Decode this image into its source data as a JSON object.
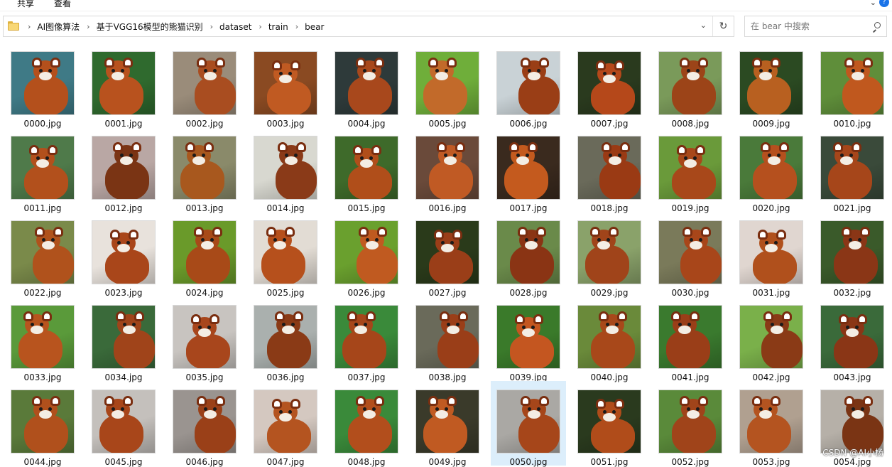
{
  "ribbon": {
    "share_label": "共享",
    "view_label": "查看"
  },
  "address": {
    "crumbs": [
      "AI图像算法",
      "基于VGG16模型的熊猫识别",
      "dataset",
      "train",
      "bear"
    ]
  },
  "search": {
    "placeholder": "在 bear 中搜索"
  },
  "files": [
    {
      "name": "0000.jpg",
      "bg": "#3f7a86",
      "fur": "#b4501c"
    },
    {
      "name": "0001.jpg",
      "bg": "#2f6a2e",
      "fur": "#b8521e"
    },
    {
      "name": "0002.jpg",
      "bg": "#9a8c7a",
      "fur": "#a94d20"
    },
    {
      "name": "0003.jpg",
      "bg": "#8a4a22",
      "fur": "#c05a22"
    },
    {
      "name": "0004.jpg",
      "bg": "#2e3a3a",
      "fur": "#a8481c"
    },
    {
      "name": "0005.jpg",
      "bg": "#6fae3a",
      "fur": "#c26a2a"
    },
    {
      "name": "0006.jpg",
      "bg": "#c9d2d6",
      "fur": "#9a3e16"
    },
    {
      "name": "0007.jpg",
      "bg": "#2a3a1e",
      "fur": "#b5481a"
    },
    {
      "name": "0008.jpg",
      "bg": "#7a9a5a",
      "fur": "#9c4418"
    },
    {
      "name": "0009.jpg",
      "bg": "#2b4a22",
      "fur": "#b86020"
    },
    {
      "name": "0010.jpg",
      "bg": "#5f8e3a",
      "fur": "#c0581e"
    },
    {
      "name": "0011.jpg",
      "bg": "#4f7a4a",
      "fur": "#b2501c"
    },
    {
      "name": "0012.jpg",
      "bg": "#b9a7a4",
      "fur": "#7a3414"
    },
    {
      "name": "0013.jpg",
      "bg": "#8a8a6a",
      "fur": "#a8581e"
    },
    {
      "name": "0014.jpg",
      "bg": "#d8d8d0",
      "fur": "#8a3a18"
    },
    {
      "name": "0015.jpg",
      "bg": "#3e6a2a",
      "fur": "#b04e1a"
    },
    {
      "name": "0016.jpg",
      "bg": "#6a4a3a",
      "fur": "#c05a24"
    },
    {
      "name": "0017.jpg",
      "bg": "#3a2a1e",
      "fur": "#c45a1e"
    },
    {
      "name": "0018.jpg",
      "bg": "#6a6a5a",
      "fur": "#9a3a14"
    },
    {
      "name": "0019.jpg",
      "bg": "#6a9a3a",
      "fur": "#a8481a"
    },
    {
      "name": "0020.jpg",
      "bg": "#4a7a3a",
      "fur": "#b5501e"
    },
    {
      "name": "0021.jpg",
      "bg": "#3a4a3a",
      "fur": "#a6461a"
    },
    {
      "name": "0022.jpg",
      "bg": "#7a8a4a",
      "fur": "#b0521c"
    },
    {
      "name": "0023.jpg",
      "bg": "#e8e2dc",
      "fur": "#a9461a"
    },
    {
      "name": "0024.jpg",
      "bg": "#6a9a2a",
      "fur": "#a84a18"
    },
    {
      "name": "0025.jpg",
      "bg": "#e2dcd4",
      "fur": "#b6501c"
    },
    {
      "name": "0026.jpg",
      "bg": "#6aa02e",
      "fur": "#c05a20"
    },
    {
      "name": "0027.jpg",
      "bg": "#2a3a1a",
      "fur": "#9a3e18"
    },
    {
      "name": "0028.jpg",
      "bg": "#6a8a4a",
      "fur": "#8a3414"
    },
    {
      "name": "0029.jpg",
      "bg": "#8aa26a",
      "fur": "#a0441a"
    },
    {
      "name": "0030.jpg",
      "bg": "#7a7a5a",
      "fur": "#a8461a"
    },
    {
      "name": "0031.jpg",
      "bg": "#e0d6d0",
      "fur": "#b0501c"
    },
    {
      "name": "0032.jpg",
      "bg": "#3a5a2a",
      "fur": "#8a3616"
    },
    {
      "name": "0033.jpg",
      "bg": "#5a9a3a",
      "fur": "#b8541e"
    },
    {
      "name": "0034.jpg",
      "bg": "#3a6a3a",
      "fur": "#a0441a"
    },
    {
      "name": "0035.jpg",
      "bg": "#c8c4c0",
      "fur": "#a8461c"
    },
    {
      "name": "0036.jpg",
      "bg": "#aab0ae",
      "fur": "#8a3a16"
    },
    {
      "name": "0037.jpg",
      "bg": "#3a8a3a",
      "fur": "#a6461a"
    },
    {
      "name": "0038.jpg",
      "bg": "#6a6a5a",
      "fur": "#9a3e18"
    },
    {
      "name": "0039.jpg",
      "bg": "#3a7a2a",
      "fur": "#c45620"
    },
    {
      "name": "0040.jpg",
      "bg": "#6a8a3a",
      "fur": "#a8481a"
    },
    {
      "name": "0041.jpg",
      "bg": "#3a7a2e",
      "fur": "#9a3e18"
    },
    {
      "name": "0042.jpg",
      "bg": "#7ab04a",
      "fur": "#8a3a16"
    },
    {
      "name": "0043.jpg",
      "bg": "#3a6a3a",
      "fur": "#8a3616"
    },
    {
      "name": "0044.jpg",
      "bg": "#5a7a3a",
      "fur": "#b0501c"
    },
    {
      "name": "0045.jpg",
      "bg": "#c4c0bc",
      "fur": "#a8461a"
    },
    {
      "name": "0046.jpg",
      "bg": "#9a9490",
      "fur": "#9a4018"
    },
    {
      "name": "0047.jpg",
      "bg": "#d4c8c0",
      "fur": "#b45420"
    },
    {
      "name": "0048.jpg",
      "bg": "#3a8a3a",
      "fur": "#b24e1c"
    },
    {
      "name": "0049.jpg",
      "bg": "#3a3a2a",
      "fur": "#c05a22"
    },
    {
      "name": "0050.jpg",
      "bg": "#aaa8a4",
      "fur": "#a6461a",
      "selected": true
    },
    {
      "name": "0051.jpg",
      "bg": "#2a3a1e",
      "fur": "#b04c1a"
    },
    {
      "name": "0052.jpg",
      "bg": "#5a8a3a",
      "fur": "#a0441a"
    },
    {
      "name": "0053.jpg",
      "bg": "#b0a090",
      "fur": "#b45420"
    },
    {
      "name": "0054.jpg",
      "bg": "#b6b0a8",
      "fur": "#7a3414"
    }
  ],
  "watermark": "CSDN @AI小杨"
}
